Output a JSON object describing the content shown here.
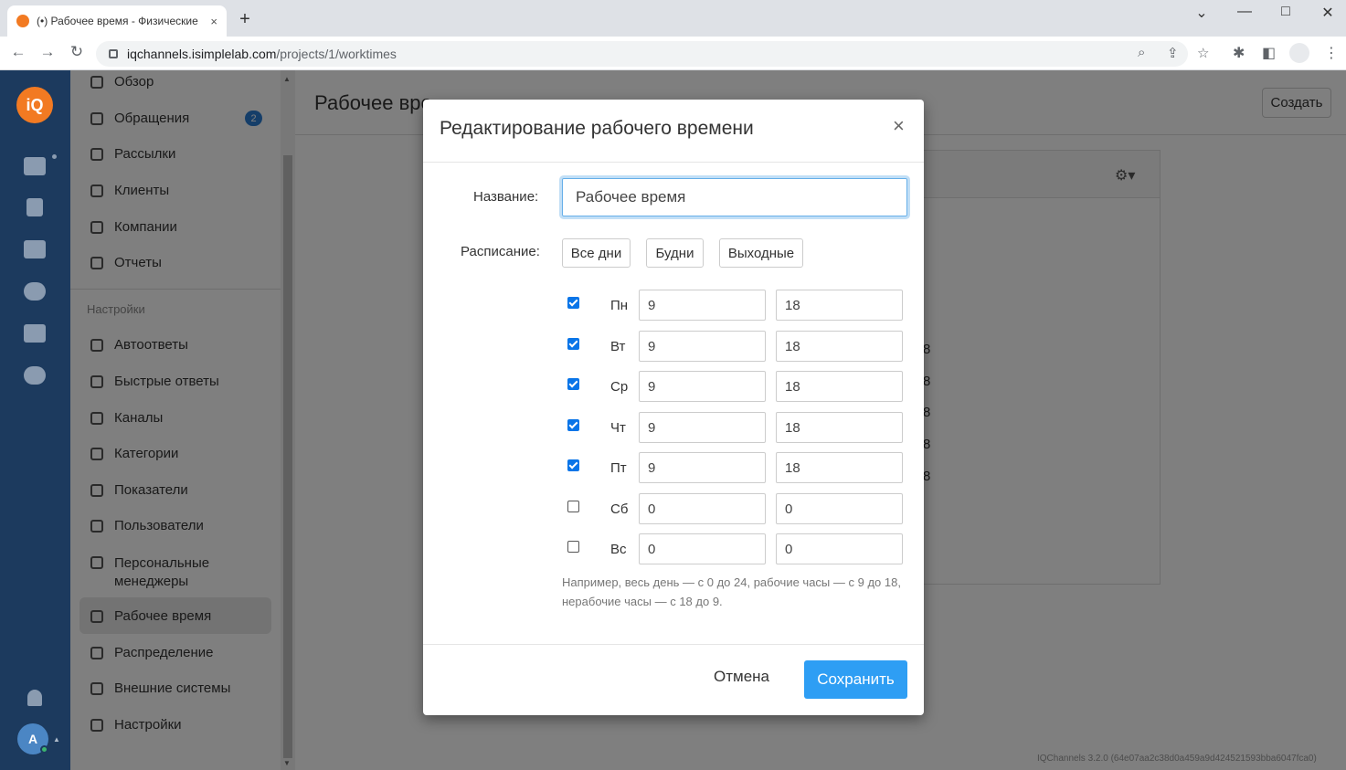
{
  "browser": {
    "tab_title": "(•) Рабочее время - Физические",
    "tab_close": "×",
    "new_tab": "+",
    "win_min": "⌄",
    "win_minimize": "—",
    "win_max": "□",
    "win_close": "✕",
    "back": "←",
    "forward": "→",
    "reload": "↻",
    "url_host": "iqchannels.isimplelab.com",
    "url_path": "/projects/1/worktimes",
    "zoom_icon": "⌕",
    "share_icon": "⇪",
    "star_icon": "☆",
    "ext_icon": "✱",
    "sidepanel_icon": "◧",
    "menu_icon": "⋮"
  },
  "rail": {
    "logo": "iQ",
    "avatar": "A",
    "avatar_caret": "▲"
  },
  "sidebar": {
    "items_top": [
      {
        "label": "Обзор",
        "icon": "dashboard-icon"
      },
      {
        "label": "Обращения",
        "icon": "chat-icon"
      },
      {
        "label": "Рассылки",
        "icon": "mail-icon"
      },
      {
        "label": "Клиенты",
        "icon": "contact-icon"
      },
      {
        "label": "Компании",
        "icon": "building-icon"
      },
      {
        "label": "Отчеты",
        "icon": "bar-chart-icon"
      }
    ],
    "badge": "2",
    "section": "Настройки",
    "items_settings": [
      {
        "label": "Автоответы",
        "icon": "reply-all-icon"
      },
      {
        "label": "Быстрые ответы",
        "icon": "speech-icon"
      },
      {
        "label": "Каналы",
        "icon": "send-icon"
      },
      {
        "label": "Категории",
        "icon": "tags-icon"
      },
      {
        "label": "Показатели",
        "icon": "target-icon"
      },
      {
        "label": "Пользователи",
        "icon": "users-icon"
      },
      {
        "label": "Персональные",
        "label2": "менеджеры",
        "icon": "users-icon"
      },
      {
        "label": "Рабочее время",
        "icon": "calendar-icon"
      },
      {
        "label": "Распределение",
        "icon": "arrows-icon"
      },
      {
        "label": "Внешние системы",
        "icon": "plug-icon"
      },
      {
        "label": "Настройки",
        "icon": "gear-icon"
      }
    ]
  },
  "main": {
    "title": "Рабочее вре",
    "create_button": "Создать",
    "gear": "⚙▾",
    "row_values": [
      "8",
      "8",
      "8",
      "8",
      "8"
    ],
    "footer": "IQChannels 3.2.0 (64e07aa2c38d0a459a9d424521593bba6047fca0)"
  },
  "modal": {
    "title": "Редактирование рабочего времени",
    "close": "×",
    "name_label": "Название:",
    "name_value": "Рабочее время",
    "schedule_label": "Расписание:",
    "quick_buttons": [
      "Все дни",
      "Будни",
      "Выходные"
    ],
    "days": [
      {
        "label": "Пн",
        "checked": true,
        "from": "9",
        "to": "18"
      },
      {
        "label": "Вт",
        "checked": true,
        "from": "9",
        "to": "18"
      },
      {
        "label": "Ср",
        "checked": true,
        "from": "9",
        "to": "18"
      },
      {
        "label": "Чт",
        "checked": true,
        "from": "9",
        "to": "18"
      },
      {
        "label": "Пт",
        "checked": true,
        "from": "9",
        "to": "18"
      },
      {
        "label": "Сб",
        "checked": false,
        "from": "0",
        "to": "0"
      },
      {
        "label": "Вс",
        "checked": false,
        "from": "0",
        "to": "0"
      }
    ],
    "hint": "Например, весь день — с 0 до 24, рабочие часы — с 9 до 18, нерабочие часы — с 18 до 9.",
    "cancel": "Отмена",
    "save": "Сохранить",
    "save_color": "#2e9ef4"
  }
}
